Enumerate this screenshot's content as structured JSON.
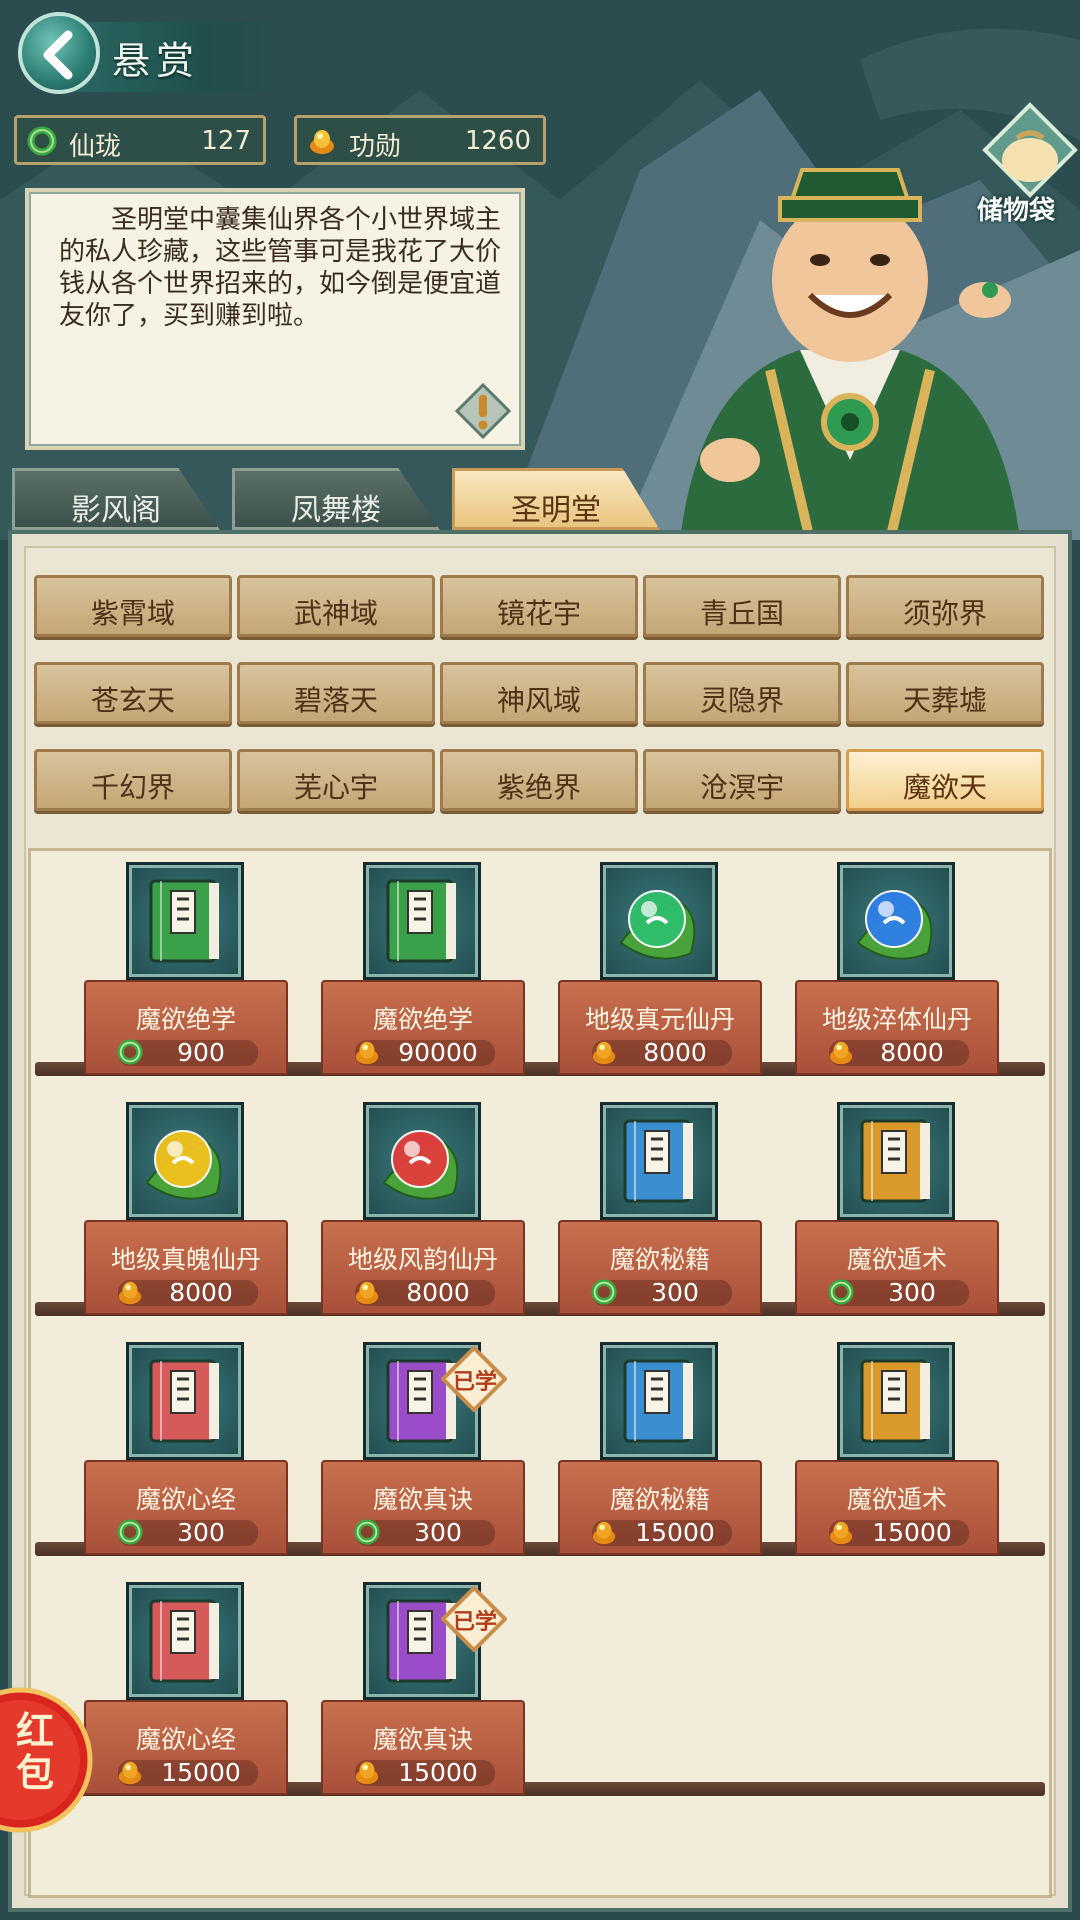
{
  "header": {
    "title": "悬赏",
    "currencies": [
      {
        "name": "仙珑",
        "value": "127",
        "icon": "jade-ring-icon"
      },
      {
        "name": "功勋",
        "value": "1260",
        "icon": "gold-ingot-icon"
      }
    ],
    "bag_label": "储物袋"
  },
  "npc": {
    "speech": "圣明堂中囊集仙界各个小世界域主的私人珍藏，这些管事可是我花了大价钱从各个世界招来的，如今倒是便宜道友你了，买到赚到啦。"
  },
  "tabs": [
    {
      "label": "影风阁",
      "active": false
    },
    {
      "label": "凤舞楼",
      "active": false
    },
    {
      "label": "圣明堂",
      "active": true
    }
  ],
  "regions": [
    [
      "紫霄域",
      "武神域",
      "镜花宇",
      "青丘国",
      "须弥界"
    ],
    [
      "苍玄天",
      "碧落天",
      "神风域",
      "灵隐界",
      "天葬墟"
    ],
    [
      "千幻界",
      "芜心宇",
      "紫绝界",
      "沧溟宇",
      "魔欲天"
    ]
  ],
  "active_region": "魔欲天",
  "items": [
    {
      "name": "魔欲绝学",
      "price": "900",
      "currency": "jade",
      "icon": "green-book-icon",
      "learned": false
    },
    {
      "name": "魔欲绝学",
      "price": "90000",
      "currency": "gold",
      "icon": "green-book-icon",
      "learned": false
    },
    {
      "name": "地级真元仙丹",
      "price": "8000",
      "currency": "gold",
      "icon": "green-pill-icon",
      "learned": false
    },
    {
      "name": "地级淬体仙丹",
      "price": "8000",
      "currency": "gold",
      "icon": "blue-pill-icon",
      "learned": false
    },
    {
      "name": "地级真魄仙丹",
      "price": "8000",
      "currency": "gold",
      "icon": "yellow-pill-icon",
      "learned": false
    },
    {
      "name": "地级风韵仙丹",
      "price": "8000",
      "currency": "gold",
      "icon": "red-pill-icon",
      "learned": false
    },
    {
      "name": "魔欲秘籍",
      "price": "300",
      "currency": "jade",
      "icon": "blue-book-icon",
      "learned": false
    },
    {
      "name": "魔欲遁术",
      "price": "300",
      "currency": "jade",
      "icon": "orange-book-icon",
      "learned": false
    },
    {
      "name": "魔欲心经",
      "price": "300",
      "currency": "jade",
      "icon": "red-book-icon",
      "learned": false
    },
    {
      "name": "魔欲真诀",
      "price": "300",
      "currency": "jade",
      "icon": "purple-book-icon",
      "learned": true
    },
    {
      "name": "魔欲秘籍",
      "price": "15000",
      "currency": "gold",
      "icon": "blue-book-icon",
      "learned": false
    },
    {
      "name": "魔欲遁术",
      "price": "15000",
      "currency": "gold",
      "icon": "orange-book-icon",
      "learned": false
    },
    {
      "name": "魔欲心经",
      "price": "15000",
      "currency": "gold",
      "icon": "red-book-icon",
      "learned": false
    },
    {
      "name": "魔欲真诀",
      "price": "15000",
      "currency": "gold",
      "icon": "purple-book-icon",
      "learned": true
    }
  ],
  "learned_badge": "已学",
  "red_packet_label": "红包",
  "colors": {
    "jade": "#3aa845",
    "gold": "#f0a624",
    "green_book": "#3aa04a",
    "blue_book": "#3b8fd0",
    "orange_book": "#d99a2b",
    "red_book": "#d65a5a",
    "purple_book": "#9a4cc9",
    "green_pill": "#2fbf6c",
    "blue_pill": "#2f7fe8",
    "yellow_pill": "#f2c21c",
    "red_pill": "#e23d3d"
  }
}
